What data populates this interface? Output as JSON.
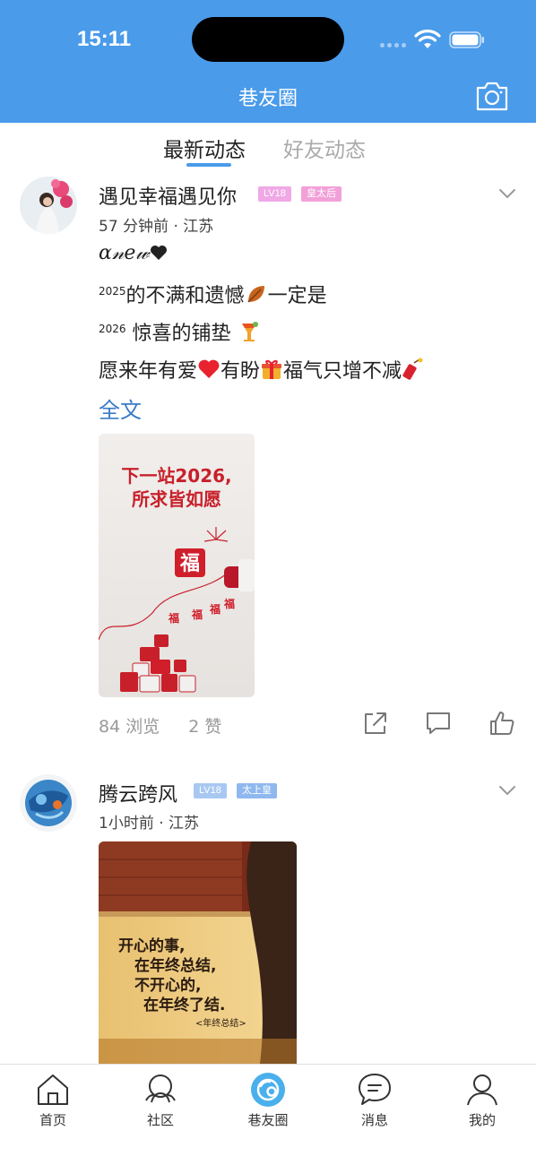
{
  "status_bar": {
    "time": "15:11"
  },
  "header": {
    "title": "巷友圈"
  },
  "tabs": [
    {
      "label": "最新动态",
      "active": true
    },
    {
      "label": "好友动态",
      "active": false
    }
  ],
  "posts": [
    {
      "username": "遇见幸福遇见你",
      "level_badge": "LV18",
      "title_badge": "皇太后",
      "meta": "57 分钟前 · 江苏",
      "content": {
        "line1": "ɑ𝓃𝑒𝓌",
        "line2_sup": "2025",
        "line2_text": "的不满和遗憾",
        "line2_tail": "一定是",
        "line3_sup": "2026",
        "line3_text": " 惊喜的铺垫 ",
        "line4_a": "愿来年有爱",
        "line4_b": "有盼",
        "line4_c": "福气只增不减"
      },
      "full_text_label": "全文",
      "image": {
        "title_line1": "下一站2026,",
        "title_line2": "所求皆如愿",
        "fu": "福"
      },
      "views": "84 浏览",
      "likes": "2 赞"
    },
    {
      "username": "腾云跨风",
      "level_badge": "LV18",
      "title_badge": "太上皇",
      "meta": "1小时前 · 江苏",
      "image": {
        "l1": "开心的事,",
        "l2": "在年终总结,",
        "l3": "不开心的,",
        "l4": "在年终了结.",
        "l5": "<年终总结>"
      }
    }
  ],
  "bottom_nav": [
    {
      "label": "首页",
      "icon": "home-icon"
    },
    {
      "label": "社区",
      "icon": "community-icon"
    },
    {
      "label": "巷友圈",
      "icon": "moments-icon",
      "active": true
    },
    {
      "label": "消息",
      "icon": "message-icon"
    },
    {
      "label": "我的",
      "icon": "profile-icon"
    }
  ],
  "colors": {
    "header_bg": "#4a9bea",
    "link": "#3a7bc8",
    "badge_level_pink": "#f0a8e6",
    "badge_title_pink": "#f2a0d8",
    "badge_level_blue": "#a8c8f2",
    "badge_title_blue": "#8fb8ee"
  }
}
